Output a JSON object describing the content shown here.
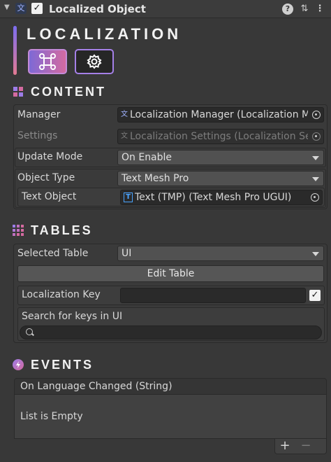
{
  "header": {
    "title": "Localized Object",
    "enabled_mark": "✓",
    "help_glyph": "?",
    "presets_glyph": "⇅",
    "menu_glyph": "⋮",
    "fold_glyph": "▼",
    "component_glyph": "文"
  },
  "brand": {
    "title": "LOCALIZATION",
    "buttons": [
      {
        "icon": "command-icon"
      },
      {
        "icon": "gear-icon"
      }
    ],
    "gradient": [
      "#7b6df0",
      "#e27a92"
    ]
  },
  "sections": {
    "content": "CONTENT",
    "tables": "TABLES",
    "events": "EVENTS"
  },
  "content": {
    "manager_label": "Manager",
    "manager_value": "Localization Manager (Localization Manager)",
    "settings_label": "Settings",
    "settings_value": "Localization Settings (Localization Settings)",
    "update_mode_label": "Update Mode",
    "update_mode_value": "On Enable",
    "object_type_label": "Object Type",
    "object_type_value": "Text Mesh Pro",
    "text_object_label": "Text Object",
    "text_object_value": "Text (TMP) (Text Mesh Pro UGUI)",
    "tmp_icon_glyph": "T"
  },
  "tables": {
    "selected_table_label": "Selected Table",
    "selected_table_value": "UI",
    "edit_table_label": "Edit Table",
    "localization_key_label": "Localization Key",
    "localization_key_value": "",
    "key_toggle_mark": "✓",
    "search_label": "Search for keys in UI",
    "search_value": ""
  },
  "events": {
    "list_header": "On Language Changed (String)",
    "empty_text": "List is Empty",
    "add_glyph": "+",
    "remove_glyph": "−"
  },
  "colors": {
    "background": "#383838",
    "field": "#2a2a2a",
    "dropdown": "#515151",
    "accent_purple": "#a580e8",
    "accent_pink": "#d46aa0"
  }
}
